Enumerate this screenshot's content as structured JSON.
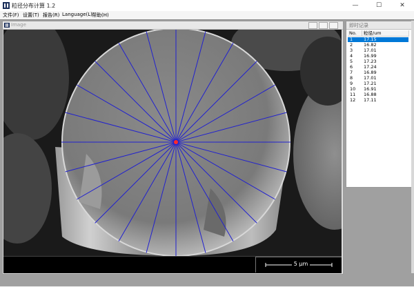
{
  "window": {
    "title": "粒径分布计算 1.2",
    "controls": {
      "minimize": "—",
      "maximize": "☐",
      "close": "✕"
    }
  },
  "menu": {
    "items": [
      {
        "label": "文件(F)"
      },
      {
        "label": "设置(T)"
      },
      {
        "label": "报告(R)"
      },
      {
        "label": "Language(L)"
      },
      {
        "label": "帮助(H)"
      }
    ]
  },
  "image_window": {
    "title": "Image",
    "scale_bar": {
      "label": "5 μm"
    }
  },
  "record_window": {
    "title": "即时记录",
    "columns": [
      "No.",
      "粒径/um"
    ],
    "selected_index": 0,
    "rows": [
      {
        "no": "1",
        "value": "17.15"
      },
      {
        "no": "2",
        "value": "16.82"
      },
      {
        "no": "3",
        "value": "17.01"
      },
      {
        "no": "4",
        "value": "16.99"
      },
      {
        "no": "5",
        "value": "17.23"
      },
      {
        "no": "6",
        "value": "17.24"
      },
      {
        "no": "7",
        "value": "16.89"
      },
      {
        "no": "8",
        "value": "17.01"
      },
      {
        "no": "9",
        "value": "17.21"
      },
      {
        "no": "10",
        "value": "16.91"
      },
      {
        "no": "11",
        "value": "16.88"
      },
      {
        "no": "12",
        "value": "17.11"
      }
    ]
  },
  "colors": {
    "measure_line": "#2020d0",
    "center_mark": "#ff2a2a",
    "selection": "#0078d7"
  }
}
